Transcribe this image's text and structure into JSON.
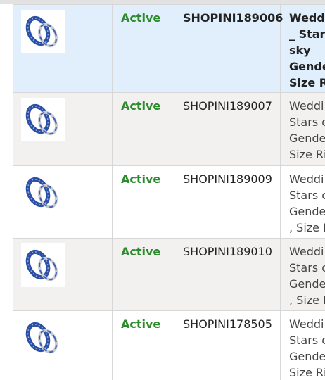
{
  "product_list": {
    "rows": [
      {
        "thumbnail_alt": "blue star couple rings",
        "status": "Active",
        "sku": "SHOPINI189006",
        "title_lines": [
          "Weddi",
          "_ Stars",
          "sky",
          "Gende",
          "Size Ri"
        ],
        "selected": true
      },
      {
        "thumbnail_alt": "blue star couple rings",
        "status": "Active",
        "sku": "SHOPINI189007",
        "title_lines": [
          "Weddi",
          "Stars o",
          "Gende",
          "Size Ri"
        ],
        "selected": false
      },
      {
        "thumbnail_alt": "blue star couple rings",
        "status": "Active",
        "sku": "SHOPINI189009",
        "title_lines": [
          "Weddi",
          "Stars o",
          "Gende",
          ", Size R"
        ],
        "selected": false
      },
      {
        "thumbnail_alt": "blue star couple rings",
        "status": "Active",
        "sku": "SHOPINI189010",
        "title_lines": [
          "Weddi",
          "Stars o",
          "Gende",
          ", Size R"
        ],
        "selected": false
      },
      {
        "thumbnail_alt": "blue star couple rings",
        "status": "Active",
        "sku": "SHOPINI178505",
        "title_lines": [
          "Weddi",
          "Stars o",
          "Gende",
          "Size Ri"
        ],
        "selected": false
      }
    ]
  },
  "colors": {
    "status_active": "#2d8a2d",
    "selected_row": "#e0effb",
    "alt_row": "#f3f1ef",
    "border": "#d7d7d7"
  }
}
